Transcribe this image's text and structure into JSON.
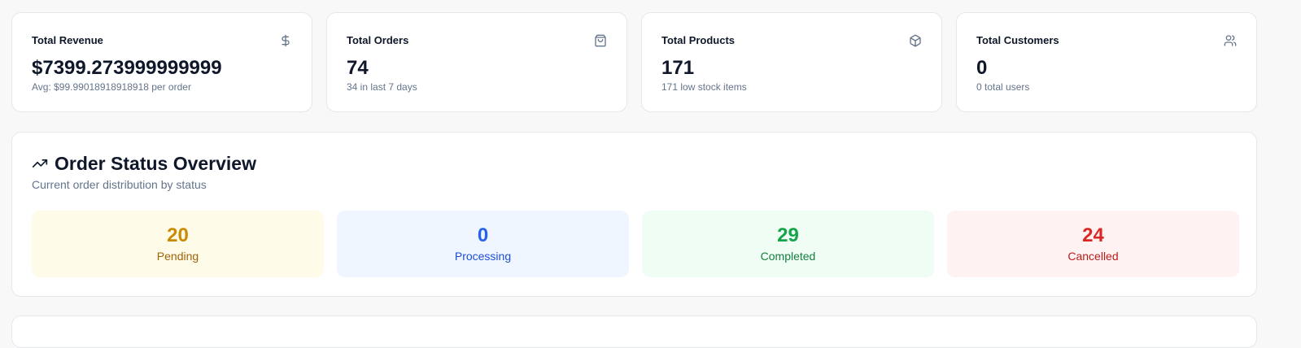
{
  "stats": [
    {
      "title": "Total Revenue",
      "value": "$7399.273999999999",
      "sub": "Avg: $99.99018918918918 per order",
      "icon": "dollar-icon"
    },
    {
      "title": "Total Orders",
      "value": "74",
      "sub": "34 in last 7 days",
      "icon": "shopping-bag-icon"
    },
    {
      "title": "Total Products",
      "value": "171",
      "sub": "171 low stock items",
      "icon": "package-icon"
    },
    {
      "title": "Total Customers",
      "value": "0",
      "sub": "0 total users",
      "icon": "users-icon"
    }
  ],
  "overview": {
    "title": "Order Status Overview",
    "subtitle": "Current order distribution by status",
    "icon": "trending-up-icon",
    "statuses": [
      {
        "count": "20",
        "label": "Pending",
        "color": "#ca8a04"
      },
      {
        "count": "0",
        "label": "Processing",
        "color": "#2563eb"
      },
      {
        "count": "29",
        "label": "Completed",
        "color": "#16a34a"
      },
      {
        "count": "24",
        "label": "Cancelled",
        "color": "#dc2626"
      }
    ]
  }
}
